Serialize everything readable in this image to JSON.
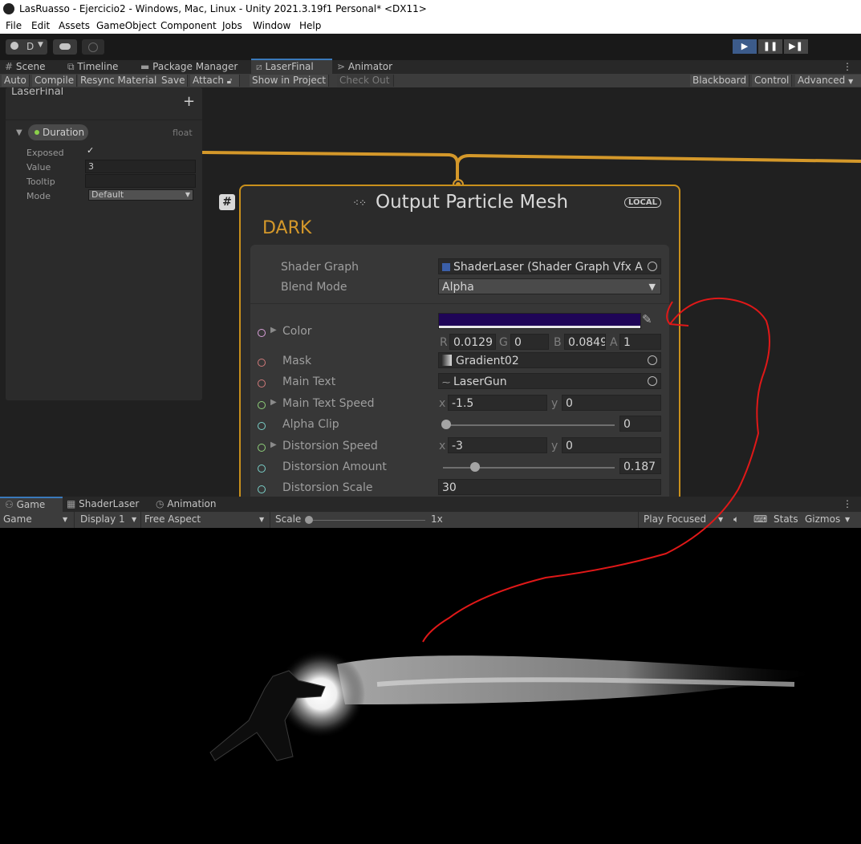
{
  "window": {
    "title": "LasRuasso - Ejercicio2 - Windows, Mac, Linux - Unity 2021.3.19f1 Personal* <DX11>"
  },
  "menu": [
    "File",
    "Edit",
    "Assets",
    "GameObject",
    "Component",
    "Jobs",
    "Window",
    "Help"
  ],
  "toolbar": {
    "account_label": "D",
    "play_icon": "play-icon",
    "pause_icon": "pause-icon",
    "step_icon": "step-icon"
  },
  "editor_tabs": [
    "Scene",
    "Timeline",
    "Package Manager",
    "LaserFinal",
    "Animator"
  ],
  "vfx_toolbar": {
    "auto": "Auto",
    "compile": "Compile",
    "resync": "Resync Material",
    "save": "Save",
    "attach": "Attach",
    "show_in_project": "Show in Project",
    "check_out": "Check Out",
    "blackboard": "Blackboard",
    "control": "Control",
    "advanced": "Advanced"
  },
  "blackboard": {
    "title": "LaserFinal",
    "add": "+",
    "property_name": "Duration",
    "property_type": "float",
    "exposed_label": "Exposed",
    "exposed_check": "✓",
    "value_label": "Value",
    "value": "3",
    "tooltip_label": "Tooltip",
    "tooltip_value": "",
    "mode_label": "Mode",
    "mode_value": "Default"
  },
  "node": {
    "hash_badge": "#",
    "title": "Output Particle Mesh",
    "space_badge": "LOCAL",
    "subtitle": "DARK",
    "shader_graph_label": "Shader Graph",
    "shader_graph_value": "ShaderLaser (Shader Graph Vfx A",
    "blend_mode_label": "Blend Mode",
    "blend_mode_value": "Alpha",
    "color_label": "Color",
    "color_hex": "#1f0557",
    "color_r_label": "R",
    "color_r": "0.0129",
    "color_g_label": "G",
    "color_g": "0",
    "color_b_label": "B",
    "color_b": "0.0849",
    "color_a_label": "A",
    "color_a": "1",
    "mask_label": "Mask",
    "mask_value": "Gradient02",
    "main_text_label": "Main Text",
    "main_text_value": "LaserGun",
    "main_text_speed_label": "Main Text Speed",
    "main_text_speed_x": "-1.5",
    "main_text_speed_y": "0",
    "alpha_clip_label": "Alpha Clip",
    "alpha_clip_value": "0",
    "alpha_clip_level": 0.0,
    "distortion_speed_label": "Distorsion Speed",
    "distortion_speed_x": "-3",
    "distortion_speed_y": "0",
    "distortion_amount_label": "Distorsion Amount",
    "distortion_amount_value": "0.187",
    "distortion_amount_level": 0.187,
    "distortion_scale_label": "Distorsion Scale",
    "distortion_scale_value": "30",
    "x_label": "x",
    "y_label": "y"
  },
  "game_tabs": [
    "Game",
    "ShaderLaser",
    "Animation"
  ],
  "game_toolbar": {
    "view": "Game",
    "display": "Display 1",
    "aspect": "Free Aspect",
    "scale_label": "Scale",
    "scale_value": "1x",
    "play_mode": "Play Focused",
    "stats": "Stats",
    "gizmos": "Gizmos"
  },
  "colors": {
    "accent_orange": "#c9901c",
    "annotation_red": "#e01818",
    "play_blue": "#3c5b8a"
  }
}
